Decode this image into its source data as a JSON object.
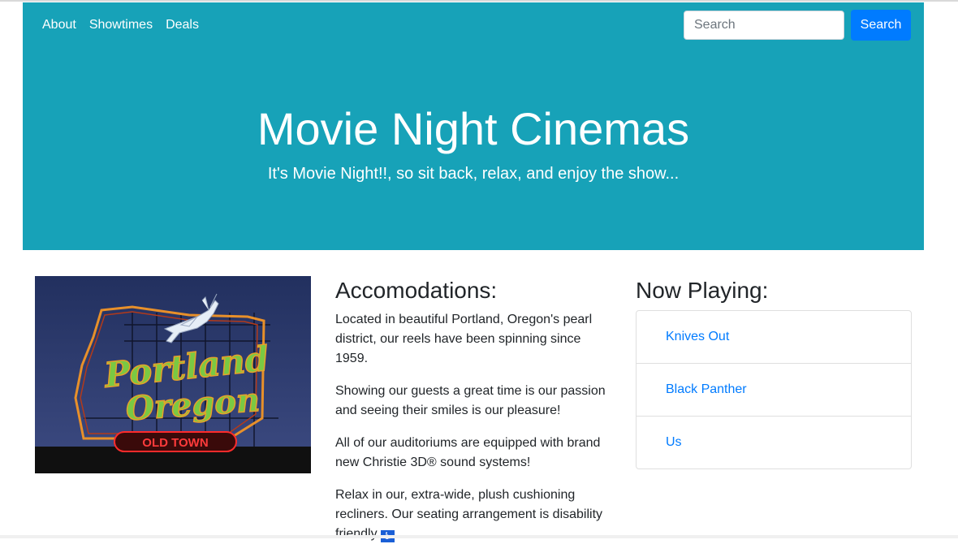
{
  "nav": {
    "links": [
      "About",
      "Showtimes",
      "Deals"
    ]
  },
  "search": {
    "placeholder": "Search",
    "button_label": "Search"
  },
  "hero": {
    "title": "Movie Night Cinemas",
    "subtitle": "It's Movie Night!!, so sit back, relax, and enjoy the show..."
  },
  "photo": {
    "sign_line1": "Portland",
    "sign_line2": "Oregon",
    "sign_line3": "OLD TOWN"
  },
  "accommodations": {
    "heading": "Accomodations:",
    "paragraphs": [
      "Located in beautiful Portland, Oregon's pearl district, our reels have been spinning since 1959.",
      "Showing our guests a great time is our passion and seeing their smiles is our pleasure!",
      "All of our auditoriums are equipped with brand new Christie 3D® sound systems!",
      "Relax in our, extra-wide, plush cushioning recliners. Our seating arrangement is disability friendly"
    ]
  },
  "now_playing": {
    "heading": "Now Playing:",
    "movies": [
      "Knives Out",
      "Black Panther",
      "Us"
    ]
  },
  "colors": {
    "hero_bg": "#17a2b8",
    "primary": "#007bff"
  }
}
